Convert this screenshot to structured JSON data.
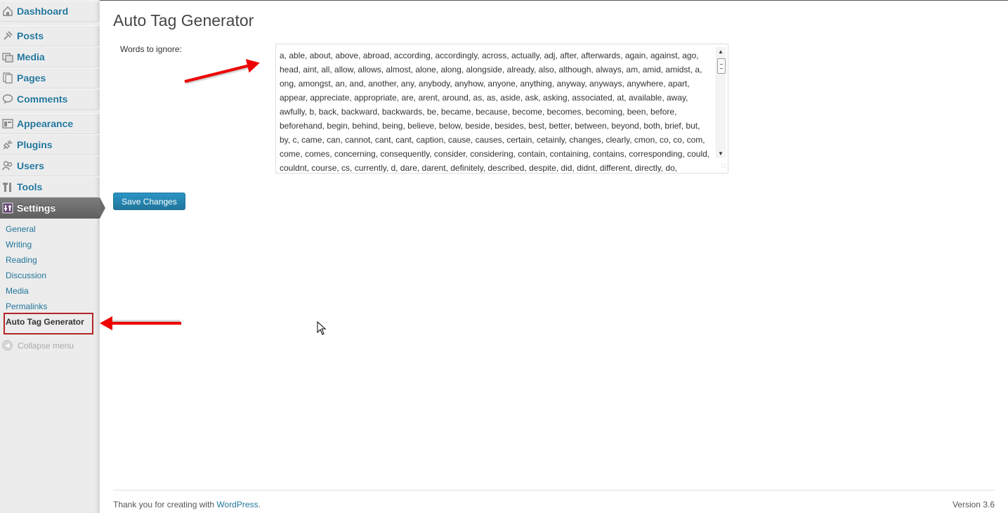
{
  "sidebar": {
    "items": [
      {
        "label": "Dashboard",
        "icon": "dashboard-icon"
      },
      {
        "label": "Posts",
        "icon": "pin-icon"
      },
      {
        "label": "Media",
        "icon": "media-icon"
      },
      {
        "label": "Pages",
        "icon": "pages-icon"
      },
      {
        "label": "Comments",
        "icon": "comment-icon"
      },
      {
        "label": "Appearance",
        "icon": "appearance-icon"
      },
      {
        "label": "Plugins",
        "icon": "plug-icon"
      },
      {
        "label": "Users",
        "icon": "users-icon"
      },
      {
        "label": "Tools",
        "icon": "tools-icon"
      },
      {
        "label": "Settings",
        "icon": "settings-icon"
      }
    ],
    "submenu": [
      "General",
      "Writing",
      "Reading",
      "Discussion",
      "Media",
      "Permalinks",
      "Auto Tag Generator"
    ],
    "collapse_label": "Collapse menu"
  },
  "page": {
    "title": "Auto Tag Generator",
    "field_label": "Words to ignore:",
    "words_to_ignore": "a, able, about, above, abroad, according, accordingly, across, actually, adj, after, afterwards, again, against, ago, head, aint, all, allow, allows, almost, alone, along, alongside, already, also, although, always, am, amid, amidst, a, ong, amongst, an, and, another, any, anybody, anyhow, anyone, anything, anyway, anyways, anywhere, apart, appear, appreciate, appropriate, are, arent, around, as, as, aside, ask, asking, associated, at, available, away, awfully, b, back, backward, backwards, be, became, because, become, becomes, becoming, been, before, beforehand, begin, behind, being, believe, below, beside, besides, best, better, between, beyond, both, brief, but, by, c, came, can, cannot, cant, cant, caption, cause, causes, certain, cetainly, changes, clearly, cmon, co, co, com, come, comes, concerning, consequently, consider, considering, contain, containing, contains, corresponding, could, couldnt, course, cs, currently, d, dare, darent, definitely, described, despite, did, didnt, different, directly, do,",
    "save_label": "Save Changes"
  },
  "footer": {
    "thanks_prefix": "Thank you for creating with ",
    "wordpress_link": "WordPress",
    "thanks_suffix": ".",
    "version": "Version 3.6"
  },
  "colors": {
    "link": "#21759b",
    "annotation_arrow": "#ee0000",
    "highlight_box": "#b32626"
  }
}
